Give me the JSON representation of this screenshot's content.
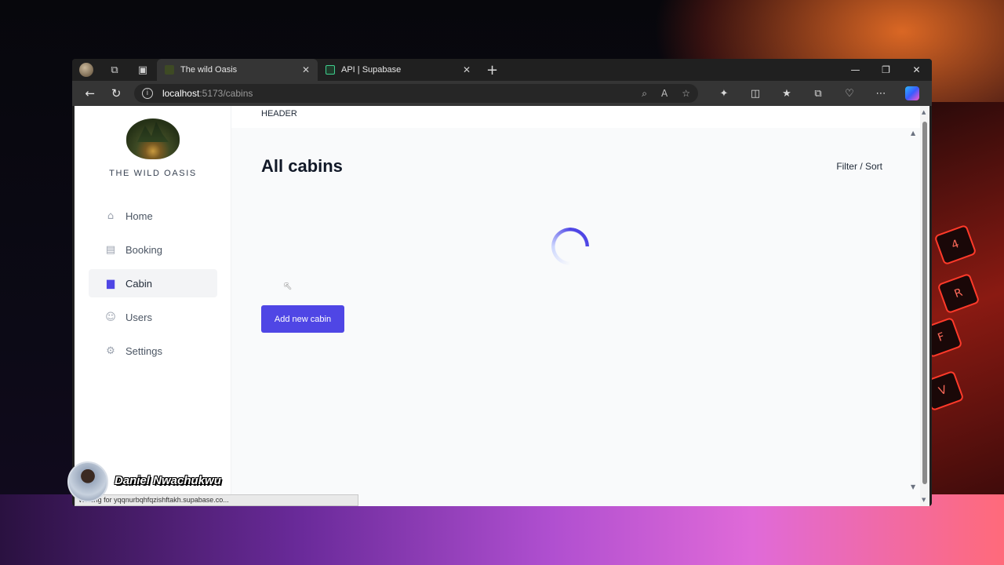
{
  "browser": {
    "tabs": [
      {
        "title": "The wild Oasis",
        "active": true
      },
      {
        "title": "API | Supabase",
        "active": false
      }
    ],
    "url_host": "localhost",
    "url_path": ":5173/cabins",
    "status_text": "Waiting for yqqnurbqhfqzishftakh.supabase.co..."
  },
  "sidebar": {
    "logo_text": "THE WILD OASIS",
    "items": [
      {
        "label": "Home",
        "icon": "home-icon",
        "active": false
      },
      {
        "label": "Booking",
        "icon": "calendar-icon",
        "active": false
      },
      {
        "label": "Cabin",
        "icon": "chart-icon",
        "active": true
      },
      {
        "label": "Users",
        "icon": "users-icon",
        "active": false
      },
      {
        "label": "Settings",
        "icon": "gear-icon",
        "active": false
      }
    ]
  },
  "header": {
    "text": "HEADER"
  },
  "main": {
    "title": "All cabins",
    "filter_sort": "Filter / Sort",
    "add_button": "Add new cabin"
  },
  "presenter": {
    "name": "Daniel Nwachukwu"
  },
  "colors": {
    "accent": "#4f46e5",
    "sidebar_bg": "#ffffff",
    "main_bg": "#f9fafb"
  }
}
